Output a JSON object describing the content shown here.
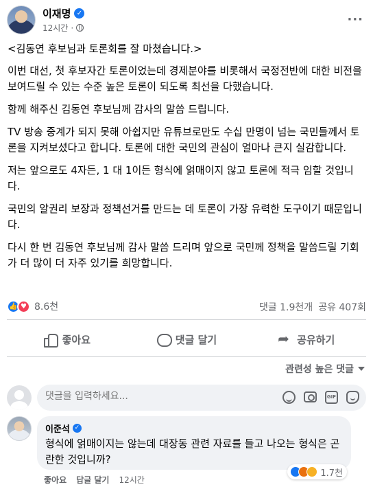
{
  "post": {
    "author": "이재명",
    "time": "12시간",
    "title": "<김동연 후보님과 토론회를 잘 마쳤습니다.>",
    "paragraphs": [
      "이번 대선, 첫 후보자간 토론이었는데 경제분야를 비롯해서 국정전반에 대한  비전을 보여드릴 수 있는 수준 높은 토론이 되도록 최선을 다했습니다.",
      "함께 해주신 김동연 후보님께 감사의 말씀 드립니다.",
      "TV 방송 중계가 되지 못해 아쉽지만 유튜브로만도 수십 만명이 넘는 국민들께서 토론을 지켜보셨다고 합니다. 토론에 대한 국민의 관심이 얼마나 큰지 실감합니다.",
      "저는 앞으로도 4자든, 1 대 1이든 형식에 얽매이지 않고 토론에 적극 임할 것입니다.",
      "국민의 알권리 보장과 정책선거를 만드는 데 토론이 가장 유력한 도구이기 때문입니다.",
      "다시 한 번 김동연 후보님께 감사 말씀 드리며 앞으로 국민께 정책을 말씀드릴 기회가 더 많이 더 자주 있기를 희망합니다."
    ],
    "reactions_count": "8.6천",
    "comments_count": "댓글 1.9천개",
    "shares_count": "공유 407회"
  },
  "actions": {
    "like": "좋아요",
    "comment": "댓글 달기",
    "share": "공유하기"
  },
  "comments_section": {
    "sort_label": "관련성 높은 댓글",
    "input_placeholder": "댓글을 입력하세요...",
    "gif_label": "GIF"
  },
  "top_comment": {
    "author": "이준석",
    "text": "형식에 얽매이지는 않는데 대장동 관련 자료를 들고 나오는 형식은 곤란한 것입니까?",
    "reactions_count": "1.7천",
    "like_label": "좋아요",
    "reply_label": "답글 달기",
    "time": "12시간"
  },
  "colors": {
    "accent": "#1877f2",
    "love": "#f33e58",
    "secondary_text": "#65676b",
    "bubble": "#f0f2f5"
  },
  "icons": [
    "verified-icon",
    "globe-icon",
    "more-icon",
    "like-reaction-icon",
    "love-reaction-icon",
    "like-icon",
    "comment-icon",
    "share-icon",
    "emoji-icon",
    "camera-icon",
    "gif-icon",
    "sticker-icon",
    "angry-reaction-icon",
    "haha-reaction-icon"
  ]
}
